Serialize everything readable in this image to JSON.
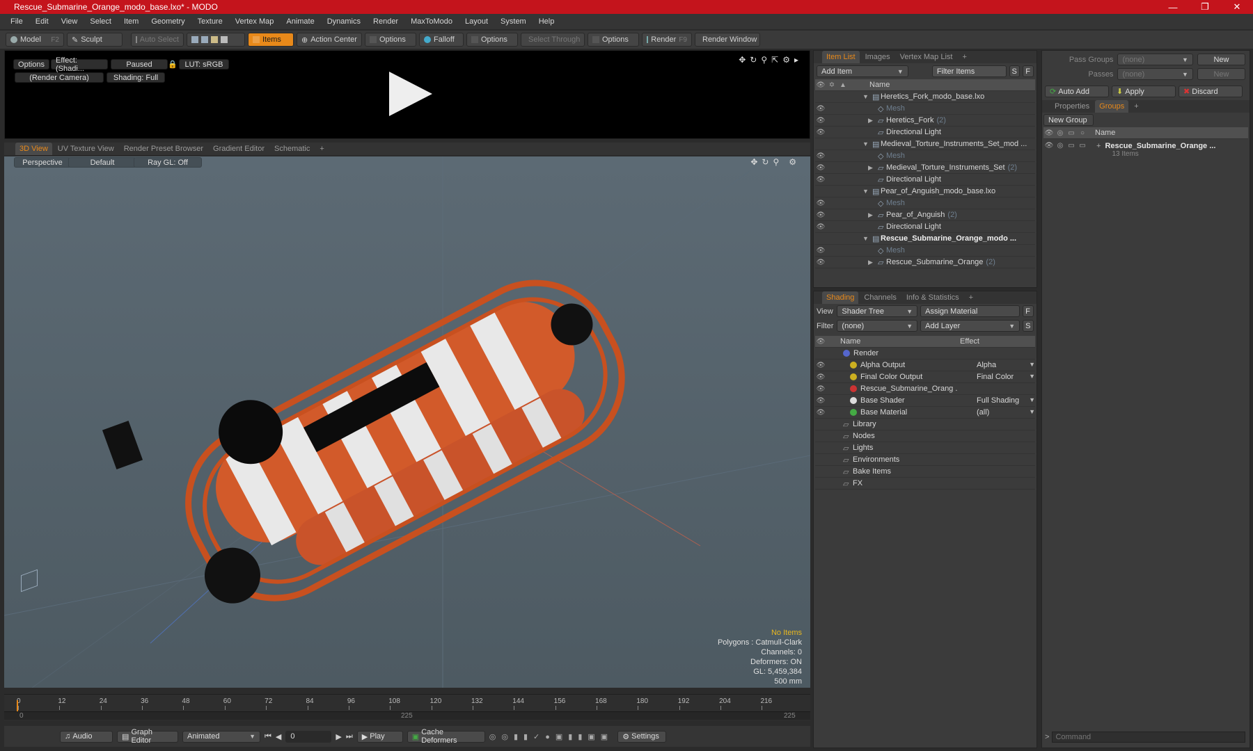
{
  "window": {
    "title": "Rescue_Submarine_Orange_modo_base.lxo* - MODO"
  },
  "menu": [
    "File",
    "Edit",
    "View",
    "Select",
    "Item",
    "Geometry",
    "Texture",
    "Vertex Map",
    "Animate",
    "Dynamics",
    "Render",
    "MaxToModo",
    "Layout",
    "System",
    "Help"
  ],
  "toolbar": {
    "model": "Model",
    "model_key": "F2",
    "sculpt": "Sculpt",
    "auto_select": "Auto Select",
    "items": "Items",
    "action_center": "Action Center",
    "options1": "Options",
    "falloff": "Falloff",
    "options2": "Options",
    "select_through": "Select Through",
    "options3": "Options",
    "render": "Render",
    "render_key": "F9",
    "render_window": "Render Window"
  },
  "preview": {
    "options": "Options",
    "effect": "Effect: (Shadi...",
    "paused": "Paused",
    "lut": "LUT: sRGB",
    "camera": "(Render Camera)",
    "shading": "Shading: Full"
  },
  "viewport_tabs": [
    "3D View",
    "UV Texture View",
    "Render Preset Browser",
    "Gradient Editor",
    "Schematic"
  ],
  "viewport": {
    "perspective": "Perspective",
    "default": "Default",
    "raygl": "Ray GL: Off",
    "stats": [
      "No Items",
      "Polygons : Catmull-Clark",
      "Channels: 0",
      "Deformers: ON",
      "GL: 5,459,384",
      "500 mm"
    ]
  },
  "timeline": {
    "ticks": [
      "0",
      "12",
      "24",
      "36",
      "48",
      "60",
      "72",
      "84",
      "96",
      "108",
      "120",
      "132",
      "144",
      "156",
      "168",
      "180",
      "192",
      "204",
      "216"
    ],
    "start": "0",
    "mid": "225",
    "end": "225"
  },
  "bottombar": {
    "audio": "Audio",
    "graph_editor": "Graph Editor",
    "animated": "Animated",
    "frame": "0",
    "play": "Play",
    "cache": "Cache Deformers",
    "settings": "Settings"
  },
  "item_list": {
    "tabs": [
      "Item List",
      "Images",
      "Vertex Map List"
    ],
    "add_item": "Add Item",
    "filter_items": "Filter Items",
    "s": "S",
    "f": "F",
    "name_header": "Name",
    "rows": [
      {
        "label": "Heretics_Fork_modo_base.lxo",
        "indent": 0,
        "muted": false,
        "bold": false,
        "count": ""
      },
      {
        "label": "Mesh",
        "indent": 2,
        "muted": true,
        "bold": false,
        "count": ""
      },
      {
        "label": "Heretics_Fork",
        "indent": 2,
        "muted": false,
        "bold": false,
        "count": "(2)"
      },
      {
        "label": "Directional Light",
        "indent": 2,
        "muted": false,
        "bold": false,
        "count": ""
      },
      {
        "label": "Medieval_Torture_Instruments_Set_mod ...",
        "indent": 0,
        "muted": false,
        "bold": false,
        "count": ""
      },
      {
        "label": "Mesh",
        "indent": 2,
        "muted": true,
        "bold": false,
        "count": ""
      },
      {
        "label": "Medieval_Torture_Instruments_Set",
        "indent": 2,
        "muted": false,
        "bold": false,
        "count": "(2)"
      },
      {
        "label": "Directional Light",
        "indent": 2,
        "muted": false,
        "bold": false,
        "count": ""
      },
      {
        "label": "Pear_of_Anguish_modo_base.lxo",
        "indent": 0,
        "muted": false,
        "bold": false,
        "count": ""
      },
      {
        "label": "Mesh",
        "indent": 2,
        "muted": true,
        "bold": false,
        "count": ""
      },
      {
        "label": "Pear_of_Anguish",
        "indent": 2,
        "muted": false,
        "bold": false,
        "count": "(2)"
      },
      {
        "label": "Directional Light",
        "indent": 2,
        "muted": false,
        "bold": false,
        "count": ""
      },
      {
        "label": "Rescue_Submarine_Orange_modo ...",
        "indent": 0,
        "muted": false,
        "bold": true,
        "count": ""
      },
      {
        "label": "Mesh",
        "indent": 2,
        "muted": true,
        "bold": false,
        "count": ""
      },
      {
        "label": "Rescue_Submarine_Orange",
        "indent": 2,
        "muted": false,
        "bold": false,
        "count": "(2)"
      }
    ]
  },
  "shading": {
    "tabs": [
      "Shading",
      "Channels",
      "Info & Statistics"
    ],
    "view_label": "View",
    "view_value": "Shader Tree",
    "assign_material": "Assign Material",
    "f": "F",
    "filter_label": "Filter",
    "filter_value": "(none)",
    "add_layer": "Add Layer",
    "s": "S",
    "name_header": "Name",
    "effect_header": "Effect",
    "rows": [
      {
        "label": "Render",
        "effect": "",
        "indent": 0,
        "eye": false,
        "color": "#5566cc"
      },
      {
        "label": "Alpha Output",
        "effect": "Alpha",
        "indent": 1,
        "eye": true,
        "color": "#ccb020"
      },
      {
        "label": "Final Color Output",
        "effect": "Final Color",
        "indent": 1,
        "eye": true,
        "color": "#ccb020"
      },
      {
        "label": "Rescue_Submarine_Orang ...",
        "effect": "",
        "indent": 1,
        "eye": true,
        "color": "#cc3333"
      },
      {
        "label": "Base Shader",
        "effect": "Full Shading",
        "indent": 1,
        "eye": true,
        "color": "#dddddd"
      },
      {
        "label": "Base Material",
        "effect": "(all)",
        "indent": 1,
        "eye": true,
        "color": "#44aa44"
      },
      {
        "label": "Library",
        "effect": "",
        "indent": 0,
        "eye": false,
        "color": ""
      },
      {
        "label": "Nodes",
        "effect": "",
        "indent": 0,
        "eye": false,
        "color": ""
      },
      {
        "label": "Lights",
        "effect": "",
        "indent": 0,
        "eye": false,
        "color": ""
      },
      {
        "label": "Environments",
        "effect": "",
        "indent": 0,
        "eye": false,
        "color": ""
      },
      {
        "label": "Bake Items",
        "effect": "",
        "indent": 0,
        "eye": false,
        "color": ""
      },
      {
        "label": "FX",
        "effect": "",
        "indent": 0,
        "eye": false,
        "color": ""
      }
    ]
  },
  "right_panel": {
    "pass_groups": "Pass Groups",
    "passes": "Passes",
    "none": "(none)",
    "new": "New",
    "auto_add": "Auto Add",
    "apply": "Apply",
    "discard": "Discard",
    "tabs": [
      "Properties",
      "Groups"
    ],
    "new_group": "New Group",
    "name_header": "Name",
    "group_name": "Rescue_Submarine_Orange ...",
    "group_count": "13 Items",
    "command_placeholder": "Command"
  }
}
